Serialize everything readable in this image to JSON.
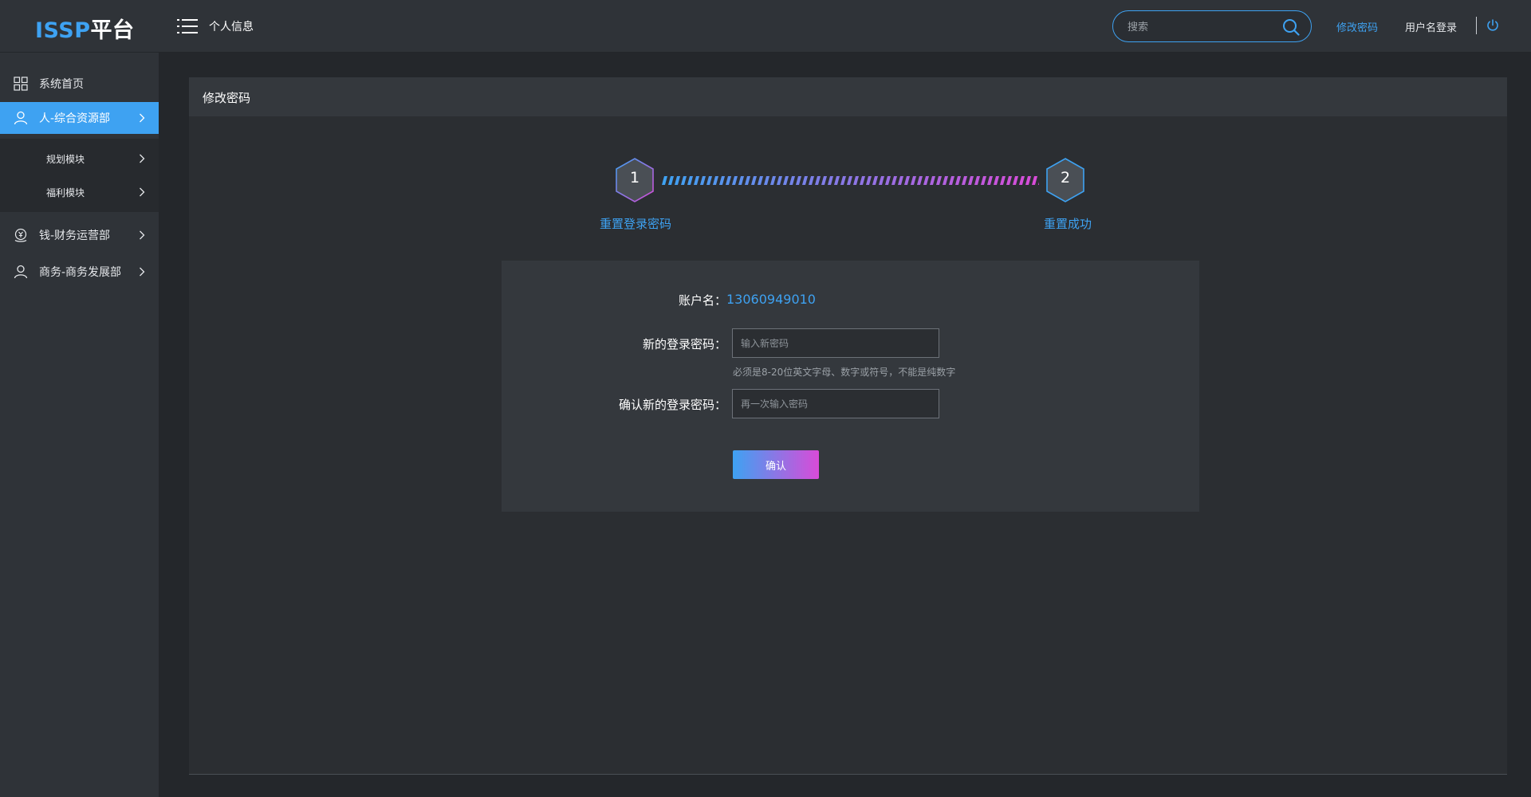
{
  "header": {
    "logo_prefix": "ISSP",
    "logo_suffix": "平台",
    "breadcrumb": "个人信息",
    "search_placeholder": "搜索",
    "change_password_link": "修改密码",
    "username_login_link": "用户名登录"
  },
  "sidebar": {
    "items": [
      {
        "label": "系统首页",
        "icon": "grid-icon"
      },
      {
        "label": "人-综合资源部",
        "icon": "user-icon",
        "active": true
      },
      {
        "label": "钱-财务运营部",
        "icon": "money-icon"
      },
      {
        "label": "商务-商务发展部",
        "icon": "user-icon"
      }
    ],
    "subitems": [
      {
        "label": "规划模块"
      },
      {
        "label": "福利模块"
      }
    ]
  },
  "panel": {
    "title": "修改密码",
    "steps": [
      {
        "number": "1",
        "label": "重置登录密码"
      },
      {
        "number": "2",
        "label": "重置成功"
      }
    ],
    "form": {
      "account_label": "账户名：",
      "account_value": "13060949010",
      "new_password_label": "新的登录密码：",
      "new_password_placeholder": "输入新密码",
      "password_hint": "必须是8-20位英文字母、数字或符号，不能是纯数字",
      "confirm_password_label": "确认新的登录密码：",
      "confirm_password_placeholder": "再一次输入密码",
      "submit_label": "确认"
    }
  },
  "colors": {
    "accent": "#3ea2f2",
    "gradient_end": "#d94bd8",
    "background": "#24272b",
    "panel": "#2b2e32"
  }
}
